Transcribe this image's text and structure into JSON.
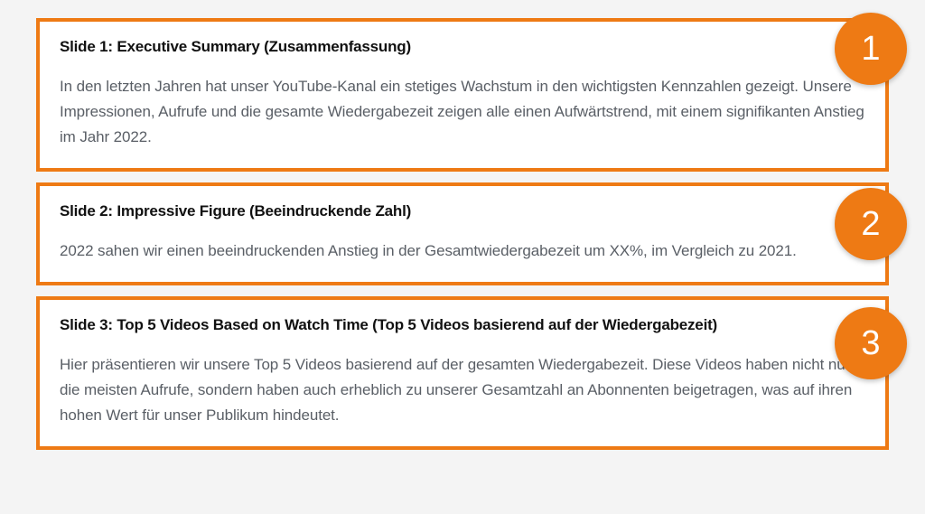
{
  "slides": [
    {
      "badge": "1",
      "title": "Slide 1: Executive Summary (Zusammenfassung)",
      "body": "In den letzten Jahren hat unser YouTube-Kanal ein stetiges Wachstum in den wichtigsten Kennzahlen gezeigt. Unsere Impressionen, Aufrufe und die gesamte Wiedergabezeit zeigen alle einen Aufwärtstrend, mit einem signifikanten Anstieg im Jahr 2022."
    },
    {
      "badge": "2",
      "title": "Slide 2: Impressive Figure (Beeindruckende Zahl)",
      "body": "2022 sahen wir einen beeindruckenden Anstieg in der Gesamtwiedergabezeit um XX%, im Vergleich zu 2021."
    },
    {
      "badge": "3",
      "title": "Slide 3: Top 5 Videos Based on Watch Time (Top 5 Videos basierend auf der Wiedergabezeit)",
      "body": "Hier präsentieren wir unsere Top 5 Videos basierend auf der gesamten Wiedergabezeit. Diese Videos haben nicht nur die meisten Aufrufe, sondern haben auch erheblich zu unserer Gesamtzahl an Abonnenten beigetragen, was auf ihren hohen Wert für unser Publikum hindeutet."
    }
  ]
}
